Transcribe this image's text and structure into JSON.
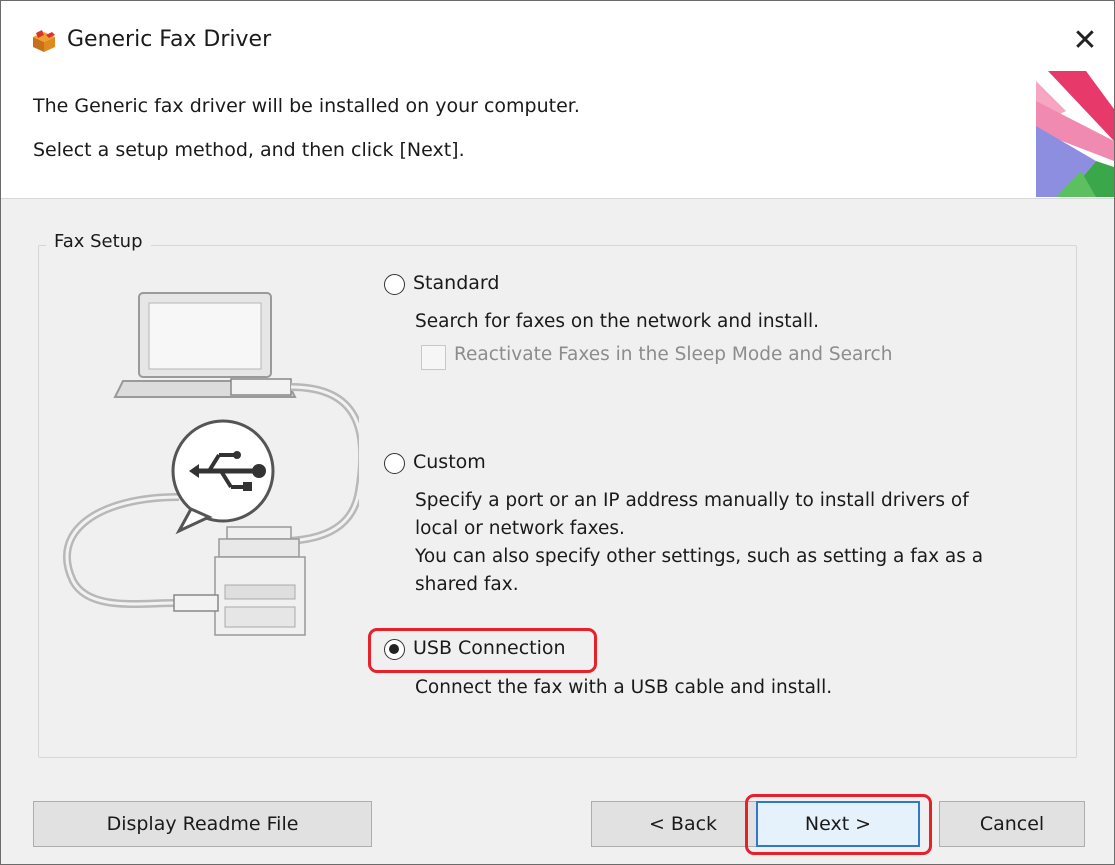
{
  "window": {
    "title": "Generic Fax Driver",
    "close_glyph": "✕"
  },
  "header": {
    "line1": "The Generic fax driver will be installed on your computer.",
    "line2": "Select a setup method, and then click [Next]."
  },
  "fax_setup": {
    "group_label": "Fax Setup",
    "options": [
      {
        "label": "Standard",
        "selected": false,
        "description": [
          "Search for faxes on the network and install."
        ],
        "checkbox": {
          "label": "Reactivate Faxes in the Sleep Mode and Search",
          "checked": false,
          "enabled": false
        }
      },
      {
        "label": "Custom",
        "selected": false,
        "description": [
          "Specify a port or an IP address manually to install drivers of",
          "local or network faxes.",
          "You can also specify other settings, such as setting a fax as a",
          "shared fax."
        ]
      },
      {
        "label": "USB Connection",
        "selected": true,
        "description": [
          "Connect the fax with a USB cable and install."
        ]
      }
    ]
  },
  "buttons": {
    "readme": "Display Readme File",
    "back": "< Back",
    "next": "Next >",
    "cancel": "Cancel"
  },
  "colors": {
    "highlight": "#e8202a",
    "default_button_border": "#2e78d0"
  },
  "icons": {
    "app": "installer-box-icon",
    "close": "close-icon",
    "illustration": "usb-connection-illustration"
  }
}
